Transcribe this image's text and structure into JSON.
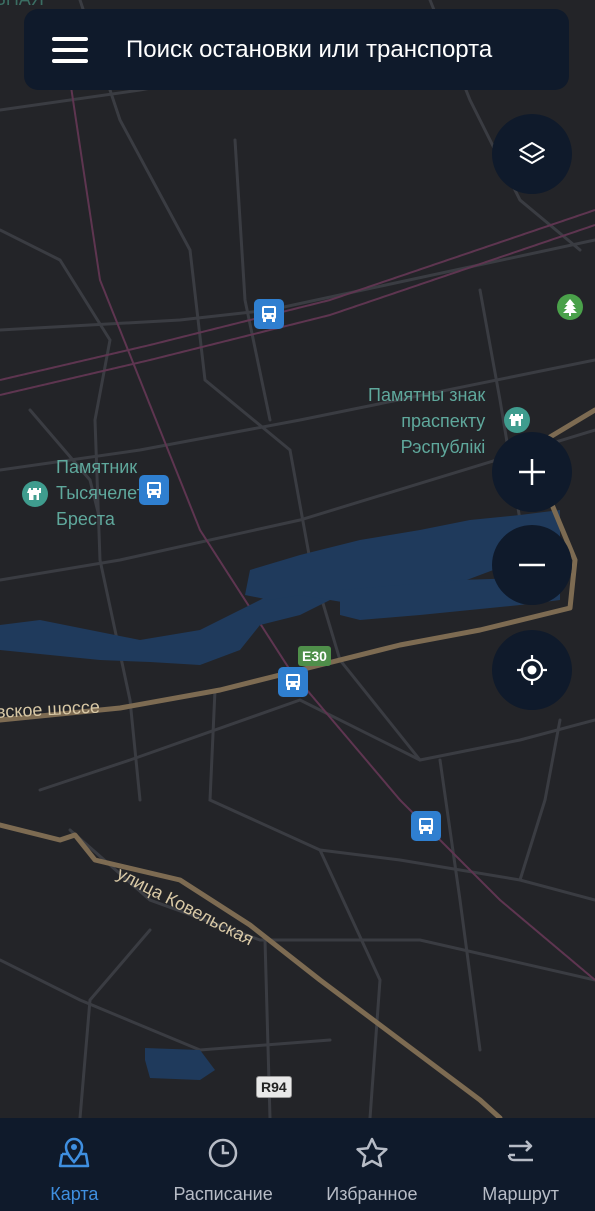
{
  "search": {
    "placeholder": "Поиск остановки или транспорта"
  },
  "map": {
    "places": [
      {
        "name": "Памятны знак\nпраспекту\nРэспублікі"
      },
      {
        "name": "Памятник\nТысячелетия\nБреста"
      }
    ],
    "road_labels": [
      {
        "text": "вское шоссе"
      },
      {
        "text": "улица Ковельская"
      }
    ],
    "route_shields": [
      {
        "text": "E30"
      },
      {
        "text": "R94"
      }
    ],
    "top_edge_label": "ЬНАЯ",
    "stop_marker_icon": "bus-icon",
    "colors": {
      "background": "#232428",
      "road_main": "#7d6b52",
      "road_minor": "#3a3c42",
      "water": "#1f3a5c",
      "rail": "#6a3a55",
      "place_label": "#5fa89c",
      "ui_panel": "#0f1a2b",
      "accent": "#3f8fe0"
    }
  },
  "controls": {
    "layers_icon": "layers-icon",
    "zoom_in_icon": "plus-icon",
    "zoom_out_icon": "minus-icon",
    "locate_icon": "locate-icon"
  },
  "nav": {
    "items": [
      {
        "label": "Карта",
        "icon": "map-pin-icon",
        "active": true
      },
      {
        "label": "Расписание",
        "icon": "clock-icon",
        "active": false
      },
      {
        "label": "Избранное",
        "icon": "star-icon",
        "active": false
      },
      {
        "label": "Маршрут",
        "icon": "route-icon",
        "active": false
      }
    ]
  }
}
